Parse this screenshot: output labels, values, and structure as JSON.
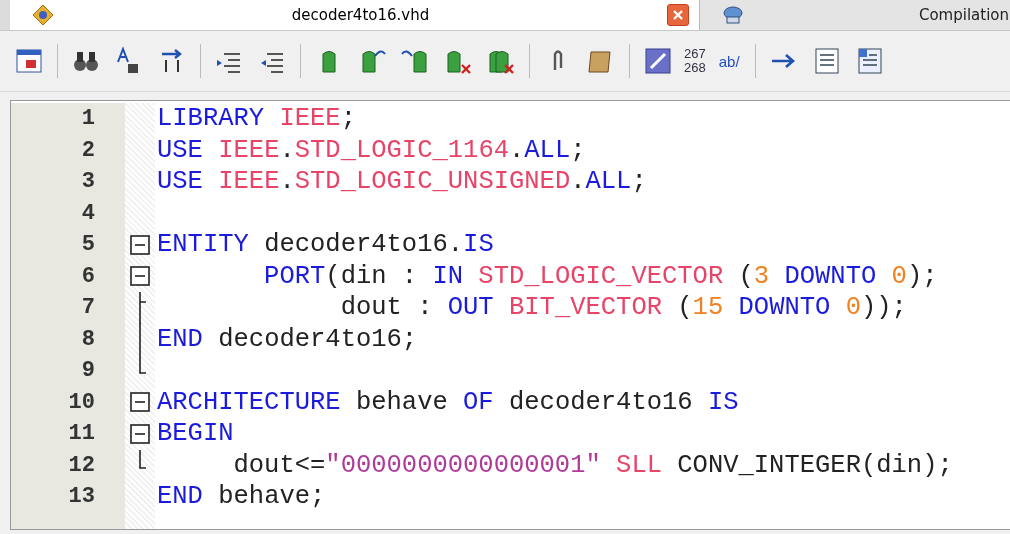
{
  "tabs": [
    {
      "title": "decoder4to16.vhd",
      "selected": true
    },
    {
      "title": "Compilation",
      "selected": false
    }
  ],
  "toolbar": {
    "numbers": [
      "267",
      "268"
    ],
    "text_label": "ab/"
  },
  "editor": {
    "lines": [
      {
        "number": "1",
        "kind": "plain",
        "tokens": [
          {
            "kind": "keyword",
            "text": "LIBRARY"
          },
          {
            "kind": "library",
            "text": " IEEE"
          },
          {
            "kind": "plain",
            "text": ";"
          }
        ]
      },
      {
        "number": "2",
        "kind": "plain",
        "tokens": [
          {
            "kind": "keyword",
            "text": "USE"
          },
          {
            "kind": "library",
            "text": " IEEE"
          },
          {
            "kind": "plain",
            "text": "."
          },
          {
            "kind": "library",
            "text": "STD_LOGIC_1164"
          },
          {
            "kind": "plain",
            "text": "."
          },
          {
            "kind": "keyword",
            "text": "ALL"
          },
          {
            "kind": "plain",
            "text": ";"
          }
        ]
      },
      {
        "number": "3",
        "kind": "plain",
        "tokens": [
          {
            "kind": "keyword",
            "text": "USE"
          },
          {
            "kind": "library",
            "text": " IEEE"
          },
          {
            "kind": "plain",
            "text": "."
          },
          {
            "kind": "library",
            "text": "STD_LOGIC_UNSIGNED"
          },
          {
            "kind": "plain",
            "text": "."
          },
          {
            "kind": "keyword",
            "text": "ALL"
          },
          {
            "kind": "plain",
            "text": ";"
          }
        ]
      },
      {
        "number": "4",
        "kind": "plain"
      },
      {
        "number": "5",
        "kind": "toggle",
        "expanded": true,
        "tokens": [
          {
            "kind": "keyword",
            "text": "ENTITY"
          },
          {
            "kind": "plain",
            "text": " decoder4to16."
          },
          {
            "kind": "keyword",
            "text": "IS"
          }
        ]
      },
      {
        "number": "6",
        "kind": "toggle",
        "expanded": true,
        "tokens": [
          {
            "kind": "keyword",
            "text": "       PORT"
          },
          {
            "kind": "plain",
            "text": "(din : "
          },
          {
            "kind": "keyword",
            "text": "IN"
          },
          {
            "kind": "library",
            "text": " STD_LOGIC_VECTOR"
          },
          {
            "kind": "plain",
            "text": " ("
          },
          {
            "kind": "number",
            "text": "3"
          },
          {
            "kind": "keyword",
            "text": " DOWNTO"
          },
          {
            "kind": "number",
            "text": " 0"
          },
          {
            "kind": "plain",
            "text": ");"
          }
        ]
      },
      {
        "number": "7",
        "kind": "branch",
        "tokens": [
          {
            "kind": "plain",
            "text": "            dout : "
          },
          {
            "kind": "keyword",
            "text": "OUT"
          },
          {
            "kind": "library",
            "text": " BIT_VECTOR"
          },
          {
            "kind": "plain",
            "text": " ("
          },
          {
            "kind": "number",
            "text": "15"
          },
          {
            "kind": "keyword",
            "text": " DOWNTO"
          },
          {
            "kind": "number",
            "text": " 0"
          },
          {
            "kind": "plain",
            "text": "));"
          }
        ]
      },
      {
        "number": "8",
        "kind": "guide",
        "tokens": [
          {
            "kind": "keyword",
            "text": "END"
          },
          {
            "kind": "plain",
            "text": " decoder4to16;"
          }
        ]
      },
      {
        "number": "9",
        "kind": "end"
      },
      {
        "number": "10",
        "kind": "toggle",
        "expanded": true,
        "tokens": [
          {
            "kind": "keyword",
            "text": "ARCHITECTURE"
          },
          {
            "kind": "plain",
            "text": " behave "
          },
          {
            "kind": "keyword",
            "text": "OF"
          },
          {
            "kind": "plain",
            "text": " decoder4to16 "
          },
          {
            "kind": "keyword",
            "text": "IS"
          }
        ]
      },
      {
        "number": "11",
        "kind": "toggle",
        "expanded": true,
        "tokens": [
          {
            "kind": "keyword",
            "text": "BEGIN"
          }
        ]
      },
      {
        "number": "12",
        "kind": "end",
        "tokens": [
          {
            "kind": "plain",
            "text": "     dout<="
          },
          {
            "kind": "string",
            "text": "\"0000000000000001\""
          },
          {
            "kind": "library",
            "text": " SLL"
          },
          {
            "kind": "plain",
            "text": " CONV_INTEGER(din);"
          }
        ]
      },
      {
        "number": "13",
        "kind": "plain",
        "tokens": [
          {
            "kind": "keyword",
            "text": "END"
          },
          {
            "kind": "plain",
            "text": " behave;"
          }
        ]
      }
    ]
  }
}
